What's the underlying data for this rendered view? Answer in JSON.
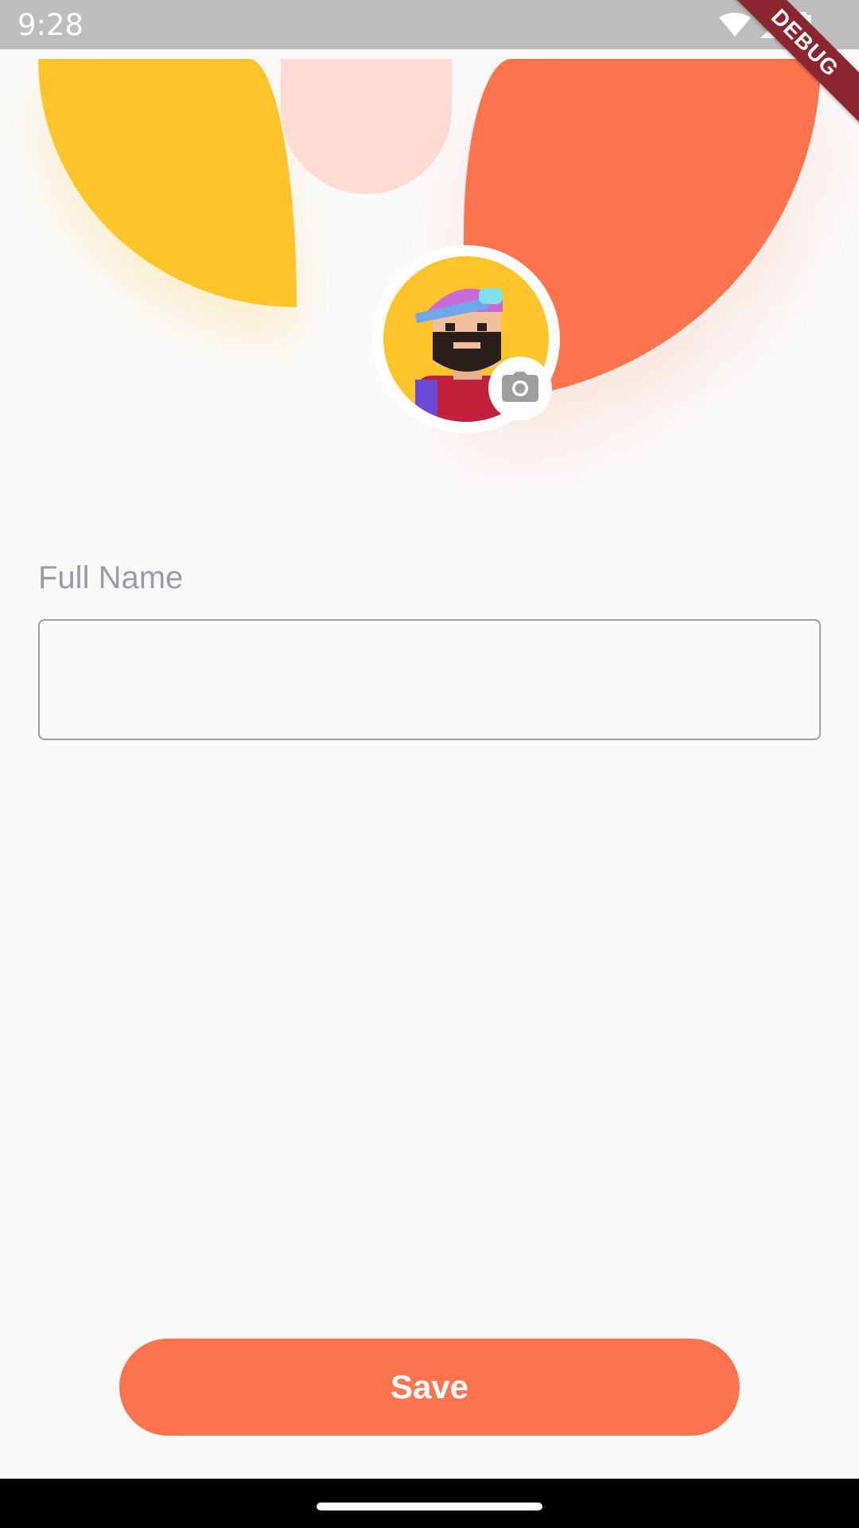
{
  "status_bar": {
    "time": "9:28",
    "icons": [
      "wifi-icon",
      "signal-icon",
      "battery-icon"
    ]
  },
  "debug_banner": "DEBUG",
  "header": {
    "colors": {
      "yellow": "#ffc42a",
      "pink": "#ffdcd3",
      "orange": "#ff744c"
    },
    "avatar_icon": "avatar-image",
    "camera_icon": "camera-icon"
  },
  "form": {
    "full_name_label": "Full Name",
    "full_name_value": "",
    "full_name_placeholder": ""
  },
  "actions": {
    "save_label": "Save"
  },
  "theme": {
    "accent": "#ff744c",
    "label_color": "#9a9aa8"
  }
}
